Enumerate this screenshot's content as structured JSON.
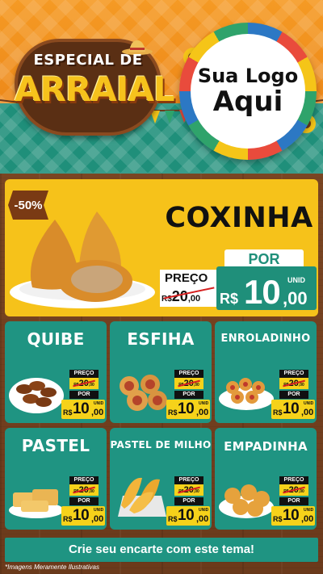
{
  "header": {
    "badge_line1": "ESPECIAL DE",
    "badge_line2": "ARRAIAL",
    "logo_line1": "Sua Logo",
    "logo_line2": "Aqui"
  },
  "feature": {
    "discount": "-50%",
    "title": "COXINHA",
    "por": "POR",
    "preco_label": "PREÇO",
    "old_currency": "R$",
    "old_int": "20",
    "old_cents": ",00",
    "new_currency": "R$",
    "new_int": "10",
    "new_cents": ",00",
    "unit": "UNID"
  },
  "products": [
    {
      "name": "QUIBE",
      "preco_label": "PREÇO",
      "old_currency": "R$",
      "old_int": "20",
      "old_cents": ",00",
      "por": "POR",
      "currency": "R$",
      "int": "10",
      "cents": ",00",
      "unit": "UNID"
    },
    {
      "name": "ESFIHA",
      "preco_label": "PREÇO",
      "old_currency": "R$",
      "old_int": "20",
      "old_cents": ",00",
      "por": "POR",
      "currency": "R$",
      "int": "10",
      "cents": ",00",
      "unit": "UNID"
    },
    {
      "name": "ENROLADINHO",
      "preco_label": "PREÇO",
      "old_currency": "R$",
      "old_int": "20",
      "old_cents": ",00",
      "por": "POR",
      "currency": "R$",
      "int": "10",
      "cents": ",00",
      "unit": "UNID"
    },
    {
      "name": "PASTEL",
      "preco_label": "PREÇO",
      "old_currency": "R$",
      "old_int": "20",
      "old_cents": ",00",
      "por": "POR",
      "currency": "R$",
      "int": "10",
      "cents": ",00",
      "unit": "UNID"
    },
    {
      "name": "PASTEL DE MILHO",
      "preco_label": "PREÇO",
      "old_currency": "R$",
      "old_int": "20",
      "old_cents": ",00",
      "por": "POR",
      "currency": "R$",
      "int": "10",
      "cents": ",00",
      "unit": "UNID"
    },
    {
      "name": "EMPADINHA",
      "preco_label": "PREÇO",
      "old_currency": "R$",
      "old_int": "20",
      "old_cents": ",00",
      "por": "POR",
      "currency": "R$",
      "int": "10",
      "cents": ",00",
      "unit": "UNID"
    }
  ],
  "footer": {
    "cta": "Crie seu encarte com este tema!",
    "disclaimer": "*Imagens Meramente Ilustrativas"
  },
  "colors": {
    "orange": "#f59a24",
    "teal": "#1f9482",
    "yellow": "#f6c21a",
    "wood": "#6b3a1b"
  }
}
